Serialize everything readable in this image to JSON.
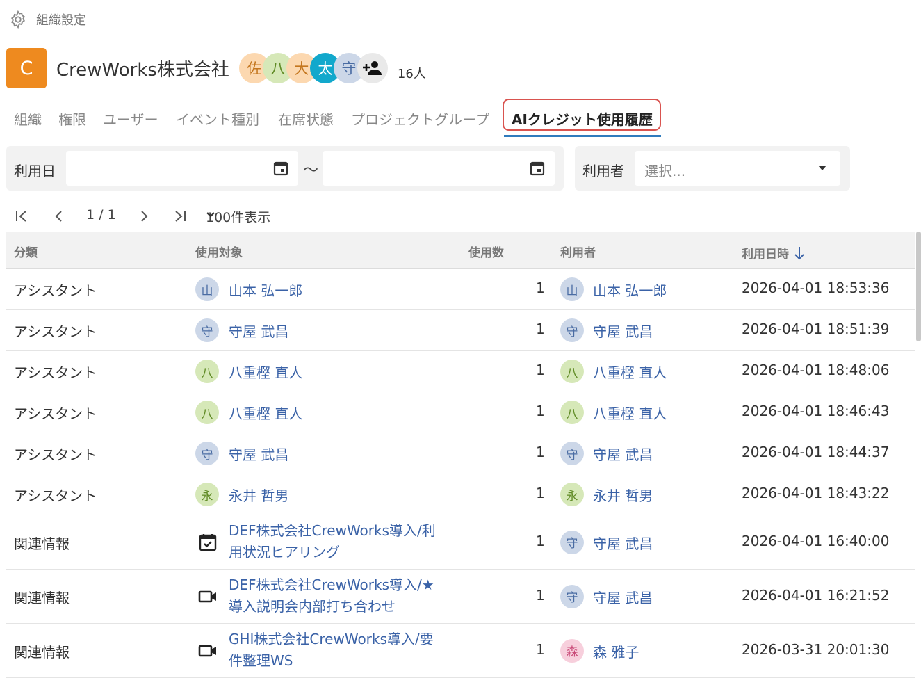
{
  "breadcrumb": {
    "icon": "gear-icon",
    "label": "組織設定"
  },
  "org": {
    "logo_letter": "C",
    "name": "CrewWorks株式会社",
    "members": [
      {
        "char": "佐",
        "bg": "#fcd8b0",
        "fg": "#c4761e"
      },
      {
        "char": "八",
        "bg": "#d6e8b8",
        "fg": "#5f8a24"
      },
      {
        "char": "大",
        "bg": "#fcd8b0",
        "fg": "#c4761e"
      },
      {
        "char": "太",
        "bg": "#12a8cc",
        "fg": "#ffffff"
      },
      {
        "char": "守",
        "bg": "#ccd7e8",
        "fg": "#4a6ca3"
      }
    ],
    "member_count": "16人"
  },
  "tabs": [
    "組織",
    "権限",
    "ユーザー",
    "イベント種別",
    "在席状態",
    "プロジェクトグループ",
    "AIクレジット使用履歴"
  ],
  "filters": {
    "date_label": "利用日",
    "range_sep": "～",
    "user_label": "利用者",
    "user_placeholder": "選択..."
  },
  "pager": {
    "page": "1 / 1",
    "per_page": "100件表示"
  },
  "table": {
    "headers": {
      "category": "分類",
      "target": "使用対象",
      "count": "使用数",
      "user": "利用者",
      "datetime": "利用日時"
    },
    "rows": [
      {
        "category": "アシスタント",
        "target_type": "user",
        "target_av": "山",
        "target_av_bg": "#ccd7e8",
        "target_av_fg": "#4a6ca3",
        "target": "山本 弘一郎",
        "count": "1",
        "user_av": "山",
        "user_av_bg": "#ccd7e8",
        "user_av_fg": "#4a6ca3",
        "user": "山本 弘一郎",
        "datetime": "2026-04-01 18:53:36"
      },
      {
        "category": "アシスタント",
        "target_type": "user",
        "target_av": "守",
        "target_av_bg": "#ccd7e8",
        "target_av_fg": "#4a6ca3",
        "target": "守屋 武昌",
        "count": "1",
        "user_av": "守",
        "user_av_bg": "#ccd7e8",
        "user_av_fg": "#4a6ca3",
        "user": "守屋 武昌",
        "datetime": "2026-04-01 18:51:39"
      },
      {
        "category": "アシスタント",
        "target_type": "user",
        "target_av": "八",
        "target_av_bg": "#d6e8b8",
        "target_av_fg": "#5f8a24",
        "target": "八重樫 直人",
        "count": "1",
        "user_av": "八",
        "user_av_bg": "#d6e8b8",
        "user_av_fg": "#5f8a24",
        "user": "八重樫 直人",
        "datetime": "2026-04-01 18:48:06"
      },
      {
        "category": "アシスタント",
        "target_type": "user",
        "target_av": "八",
        "target_av_bg": "#d6e8b8",
        "target_av_fg": "#5f8a24",
        "target": "八重樫 直人",
        "count": "1",
        "user_av": "八",
        "user_av_bg": "#d6e8b8",
        "user_av_fg": "#5f8a24",
        "user": "八重樫 直人",
        "datetime": "2026-04-01 18:46:43"
      },
      {
        "category": "アシスタント",
        "target_type": "user",
        "target_av": "守",
        "target_av_bg": "#ccd7e8",
        "target_av_fg": "#4a6ca3",
        "target": "守屋 武昌",
        "count": "1",
        "user_av": "守",
        "user_av_bg": "#ccd7e8",
        "user_av_fg": "#4a6ca3",
        "user": "守屋 武昌",
        "datetime": "2026-04-01 18:44:37"
      },
      {
        "category": "アシスタント",
        "target_type": "user",
        "target_av": "永",
        "target_av_bg": "#d6e8b8",
        "target_av_fg": "#5f8a24",
        "target": "永井 哲男",
        "count": "1",
        "user_av": "永",
        "user_av_bg": "#d6e8b8",
        "user_av_fg": "#5f8a24",
        "user": "永井 哲男",
        "datetime": "2026-04-01 18:43:22"
      },
      {
        "category": "関連情報",
        "target_type": "event",
        "target_icon": "calendar-check-icon",
        "target_line1": "DEF株式会社CrewWorks導入/利",
        "target_line2": "用状況ヒアリング",
        "count": "1",
        "user_av": "守",
        "user_av_bg": "#ccd7e8",
        "user_av_fg": "#4a6ca3",
        "user": "守屋 武昌",
        "datetime": "2026-04-01 16:40:00"
      },
      {
        "category": "関連情報",
        "target_type": "meeting",
        "target_icon": "video-camera-icon",
        "target_line1": "DEF株式会社CrewWorks導入/★",
        "target_line2": "導入説明会内部打ち合わせ",
        "count": "1",
        "user_av": "守",
        "user_av_bg": "#ccd7e8",
        "user_av_fg": "#4a6ca3",
        "user": "守屋 武昌",
        "datetime": "2026-04-01 16:21:52"
      },
      {
        "category": "関連情報",
        "target_type": "meeting",
        "target_icon": "video-camera-icon",
        "target_line1": "GHI株式会社CrewWorks導入/要",
        "target_line2": "件整理WS",
        "count": "1",
        "user_av": "森",
        "user_av_bg": "#f7cfdc",
        "user_av_fg": "#c94a78",
        "user": "森 雅子",
        "datetime": "2026-03-31 20:01:30"
      }
    ]
  },
  "colors": {
    "accent": "#2f7bbd",
    "link": "#3a62a7",
    "logo": "#ee8a1f",
    "highlight": "#d9534f"
  }
}
